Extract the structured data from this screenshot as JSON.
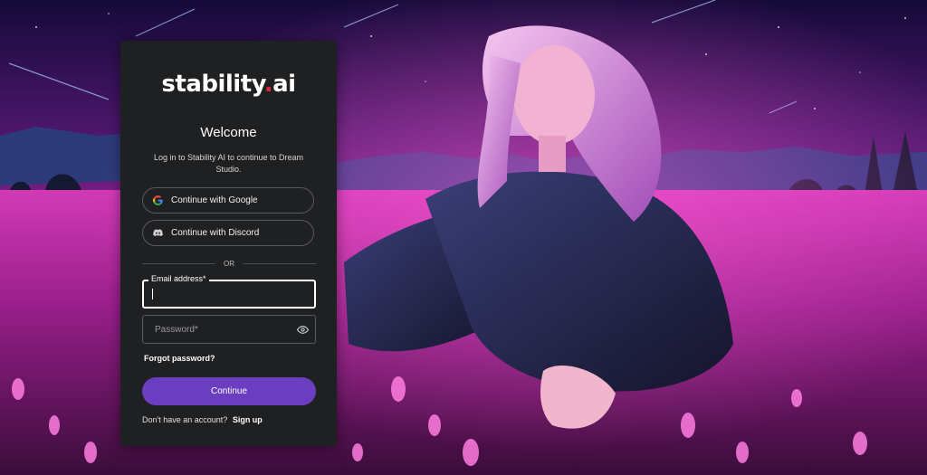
{
  "brand": {
    "logo_prefix": "stability",
    "logo_dot": ".",
    "logo_suffix": "ai",
    "accent_color": "#e0243c"
  },
  "login": {
    "heading": "Welcome",
    "subtitle": "Log in to Stability AI to continue to Dream Studio.",
    "google_label": "Continue with Google",
    "discord_label": "Continue with Discord",
    "divider_text": "OR",
    "email_label": "Email address*",
    "email_value": "",
    "password_placeholder": "Password*",
    "forgot_label": "Forgot password?",
    "continue_label": "Continue",
    "continue_color": "#6b3ec1",
    "no_account_text": "Don't have an account?",
    "signup_label": "Sign up"
  },
  "icons": {
    "google": "google-icon",
    "discord": "discord-icon",
    "password_toggle": "eye-icon"
  },
  "background": {
    "description_colors": [
      "#1a0830",
      "#b0178f",
      "#e23cc0",
      "#2a2f6a"
    ]
  }
}
